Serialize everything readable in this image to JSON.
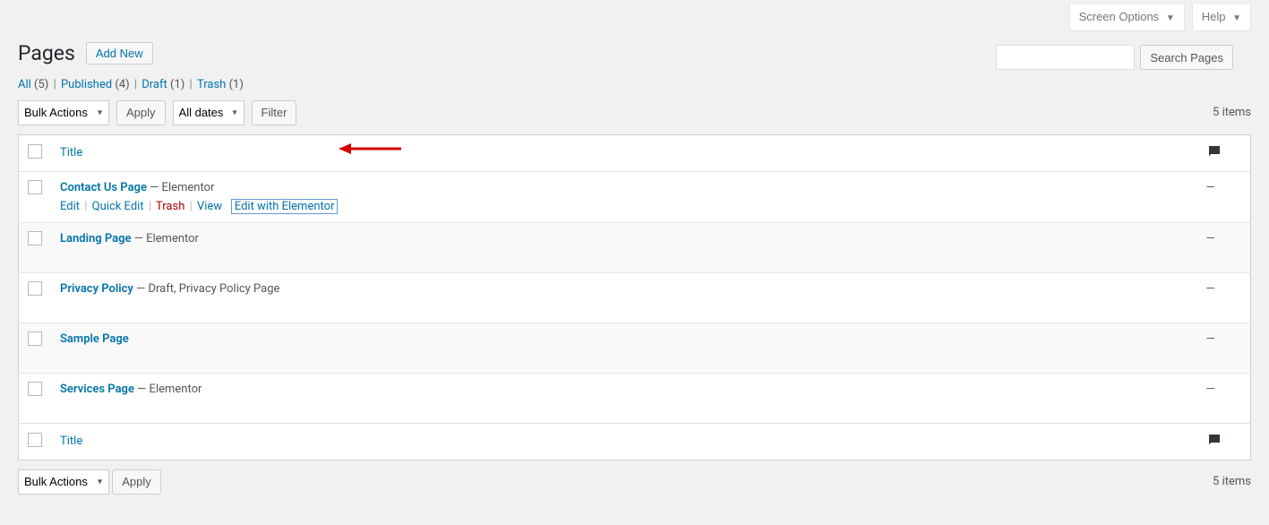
{
  "top": {
    "screen_options": "Screen Options",
    "help": "Help"
  },
  "header": {
    "title": "Pages",
    "add_new": "Add New"
  },
  "filters": {
    "all": "All",
    "all_count": "(5)",
    "published": "Published",
    "published_count": "(4)",
    "draft": "Draft",
    "draft_count": "(1)",
    "trash": "Trash",
    "trash_count": "(1)"
  },
  "search": {
    "button": "Search Pages"
  },
  "toolbar": {
    "bulk_actions": "Bulk Actions",
    "apply": "Apply",
    "all_dates": "All dates",
    "filter": "Filter",
    "items_count": "5 items"
  },
  "table": {
    "title_col": "Title",
    "rows": [
      {
        "title": "Contact Us Page",
        "suffix": " — Elementor",
        "comments": "—"
      },
      {
        "title": "Landing Page",
        "suffix": " — Elementor",
        "comments": "—"
      },
      {
        "title": "Privacy Policy",
        "suffix": " — Draft, Privacy Policy Page",
        "comments": "—"
      },
      {
        "title": "Sample Page",
        "suffix": "",
        "comments": "—"
      },
      {
        "title": "Services Page",
        "suffix": " — Elementor",
        "comments": "—"
      }
    ],
    "actions": {
      "edit": "Edit",
      "quick_edit": "Quick Edit",
      "trash": "Trash",
      "view": "View",
      "edit_elementor": "Edit with Elementor"
    }
  },
  "bottom": {
    "bulk_actions": "Bulk Actions",
    "apply": "Apply",
    "items_count": "5 items"
  }
}
